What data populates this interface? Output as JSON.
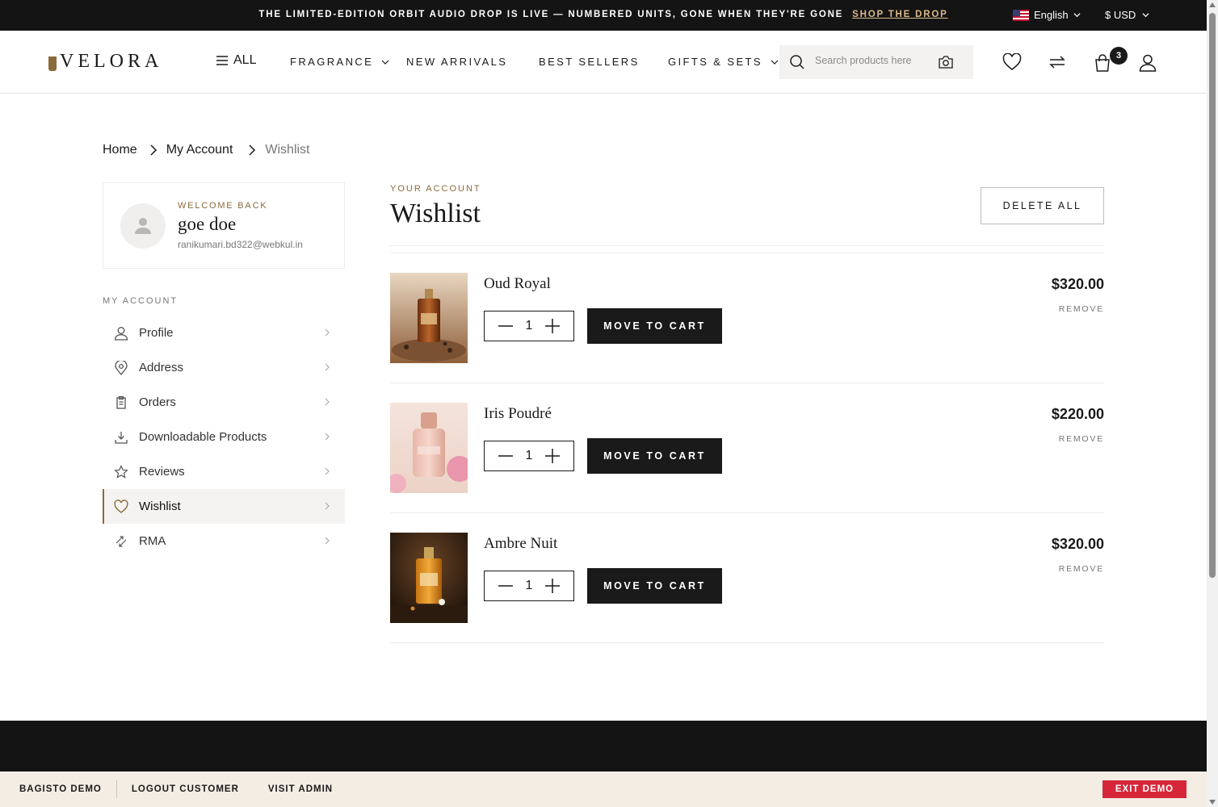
{
  "announcement": {
    "text": "THE LIMITED-EDITION ORBIT AUDIO DROP IS LIVE — NUMBERED UNITS, GONE WHEN THEY'RE GONE",
    "link": "SHOP THE DROP"
  },
  "locale": {
    "language": "English",
    "currency": "$ USD"
  },
  "header": {
    "logo": "VELORA",
    "all_label": "ALL",
    "nav": [
      {
        "label": "FRAGRANCE",
        "has_dropdown": true
      },
      {
        "label": "NEW ARRIVALS",
        "has_dropdown": false
      },
      {
        "label": "BEST SELLERS",
        "has_dropdown": false
      },
      {
        "label": "GIFTS & SETS",
        "has_dropdown": true
      }
    ],
    "search_placeholder": "Search products here",
    "cart_count": "3"
  },
  "breadcrumb": {
    "home": "Home",
    "account": "My Account",
    "current": "Wishlist"
  },
  "profile": {
    "welcome": "WELCOME BACK",
    "name": "goe doe",
    "email": "ranikumari.bd322@webkul.in"
  },
  "sidebar": {
    "heading": "MY ACCOUNT",
    "items": [
      {
        "label": "Profile",
        "icon": "user-icon"
      },
      {
        "label": "Address",
        "icon": "location-pin-icon"
      },
      {
        "label": "Orders",
        "icon": "clipboard-icon"
      },
      {
        "label": "Downloadable Products",
        "icon": "download-icon"
      },
      {
        "label": "Reviews",
        "icon": "star-icon"
      },
      {
        "label": "Wishlist",
        "icon": "heart-icon",
        "active": true
      },
      {
        "label": "RMA",
        "icon": "exchange-icon"
      }
    ]
  },
  "main": {
    "eyebrow": "YOUR ACCOUNT",
    "title": "Wishlist",
    "delete_all": "DELETE ALL",
    "move_label": "MOVE TO CART",
    "remove_label": "REMOVE",
    "items": [
      {
        "name": "Oud Royal",
        "qty": "1",
        "price": "$320.00"
      },
      {
        "name": "Iris Poudré",
        "qty": "1",
        "price": "$220.00"
      },
      {
        "name": "Ambre Nuit",
        "qty": "1",
        "price": "$320.00"
      }
    ]
  },
  "demo_bar": {
    "brand": "BAGISTO DEMO",
    "logout": "LOGOUT CUSTOMER",
    "admin": "VISIT ADMIN",
    "exit": "EXIT DEMO"
  },
  "colors": {
    "accent": "#8c6a3c",
    "dark": "#151414",
    "danger": "#d6273a",
    "demo_bar_bg": "#f3ede4"
  }
}
